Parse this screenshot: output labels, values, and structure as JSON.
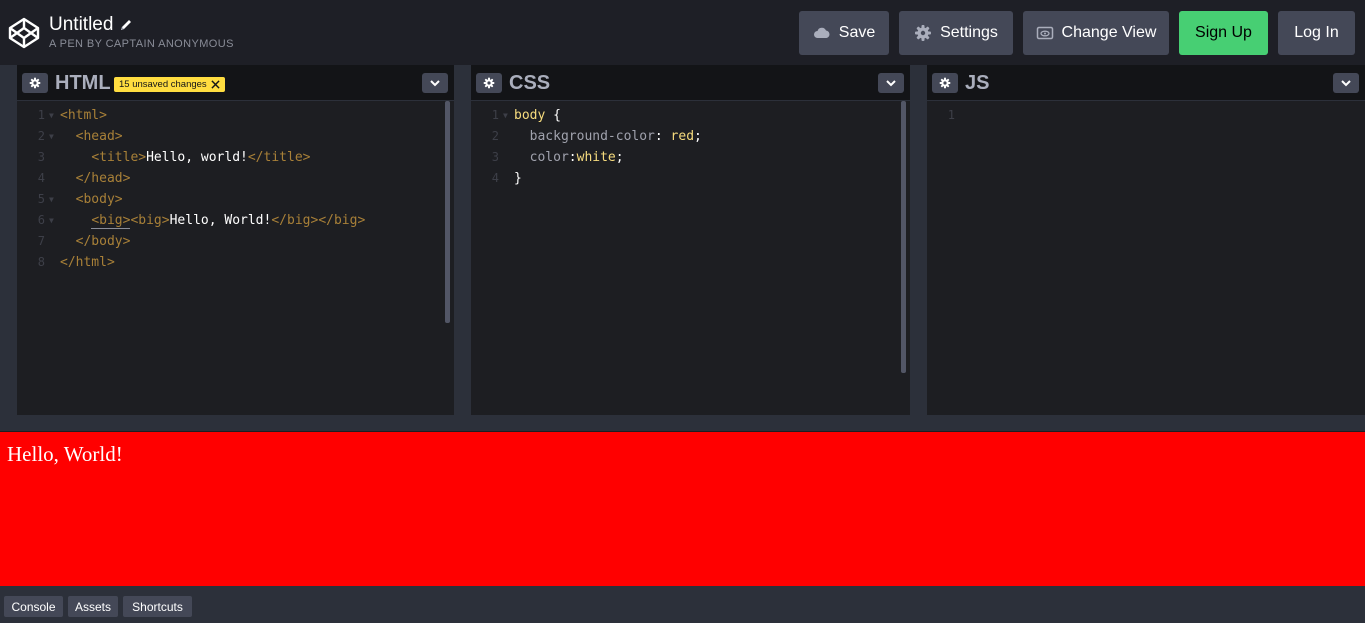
{
  "header": {
    "title": "Untitled",
    "subtitle": "A PEN BY CAPTAIN ANONYMOUS",
    "buttons": {
      "save": "Save",
      "settings": "Settings",
      "change_view": "Change View",
      "sign_up": "Sign Up",
      "log_in": "Log In"
    },
    "icons": [
      "codepen-logo-icon",
      "pencil-icon",
      "cloud-icon",
      "gear-icon",
      "eye-icon"
    ]
  },
  "editors": {
    "html": {
      "title": "HTML",
      "badge": "15 unsaved changes",
      "lines": [
        {
          "n": "1",
          "fold": true
        },
        {
          "n": "2",
          "fold": true
        },
        {
          "n": "3",
          "fold": false
        },
        {
          "n": "4",
          "fold": false
        },
        {
          "n": "5",
          "fold": true
        },
        {
          "n": "6",
          "fold": true
        },
        {
          "n": "7",
          "fold": false
        },
        {
          "n": "8",
          "fold": false
        }
      ],
      "code": {
        "l1_open": "<html>",
        "l2_open": "<head>",
        "l3_open": "<title>",
        "l3_text": "Hello, world!",
        "l3_close": "</title>",
        "l4_close": "</head>",
        "l5_open": "<body>",
        "l6_open1": "<big>",
        "l6_open2": "<big>",
        "l6_text": "Hello, World!",
        "l6_close1": "</big>",
        "l6_close2": "</big>",
        "l7_close": "</body>",
        "l8_close": "</html>"
      }
    },
    "css": {
      "title": "CSS",
      "lines": [
        {
          "n": "1",
          "fold": true
        },
        {
          "n": "2",
          "fold": false
        },
        {
          "n": "3",
          "fold": false
        },
        {
          "n": "4",
          "fold": false
        }
      ],
      "code": {
        "selector": "body",
        "open_brace": " {",
        "prop1": "background-color",
        "val1": " red",
        "prop2": "color",
        "val2": "white",
        "close_brace": "}"
      }
    },
    "js": {
      "title": "JS",
      "lines": [
        {
          "n": "1",
          "fold": false
        }
      ]
    }
  },
  "preview": {
    "text": "Hello, World!",
    "background": "#ff0000",
    "color": "#ffffff"
  },
  "footer": {
    "console": "Console",
    "assets": "Assets",
    "shortcuts": "Shortcuts"
  },
  "colors": {
    "accent_green": "#47cf73",
    "badge_yellow": "#ffdd40",
    "button_gray": "#444857"
  }
}
